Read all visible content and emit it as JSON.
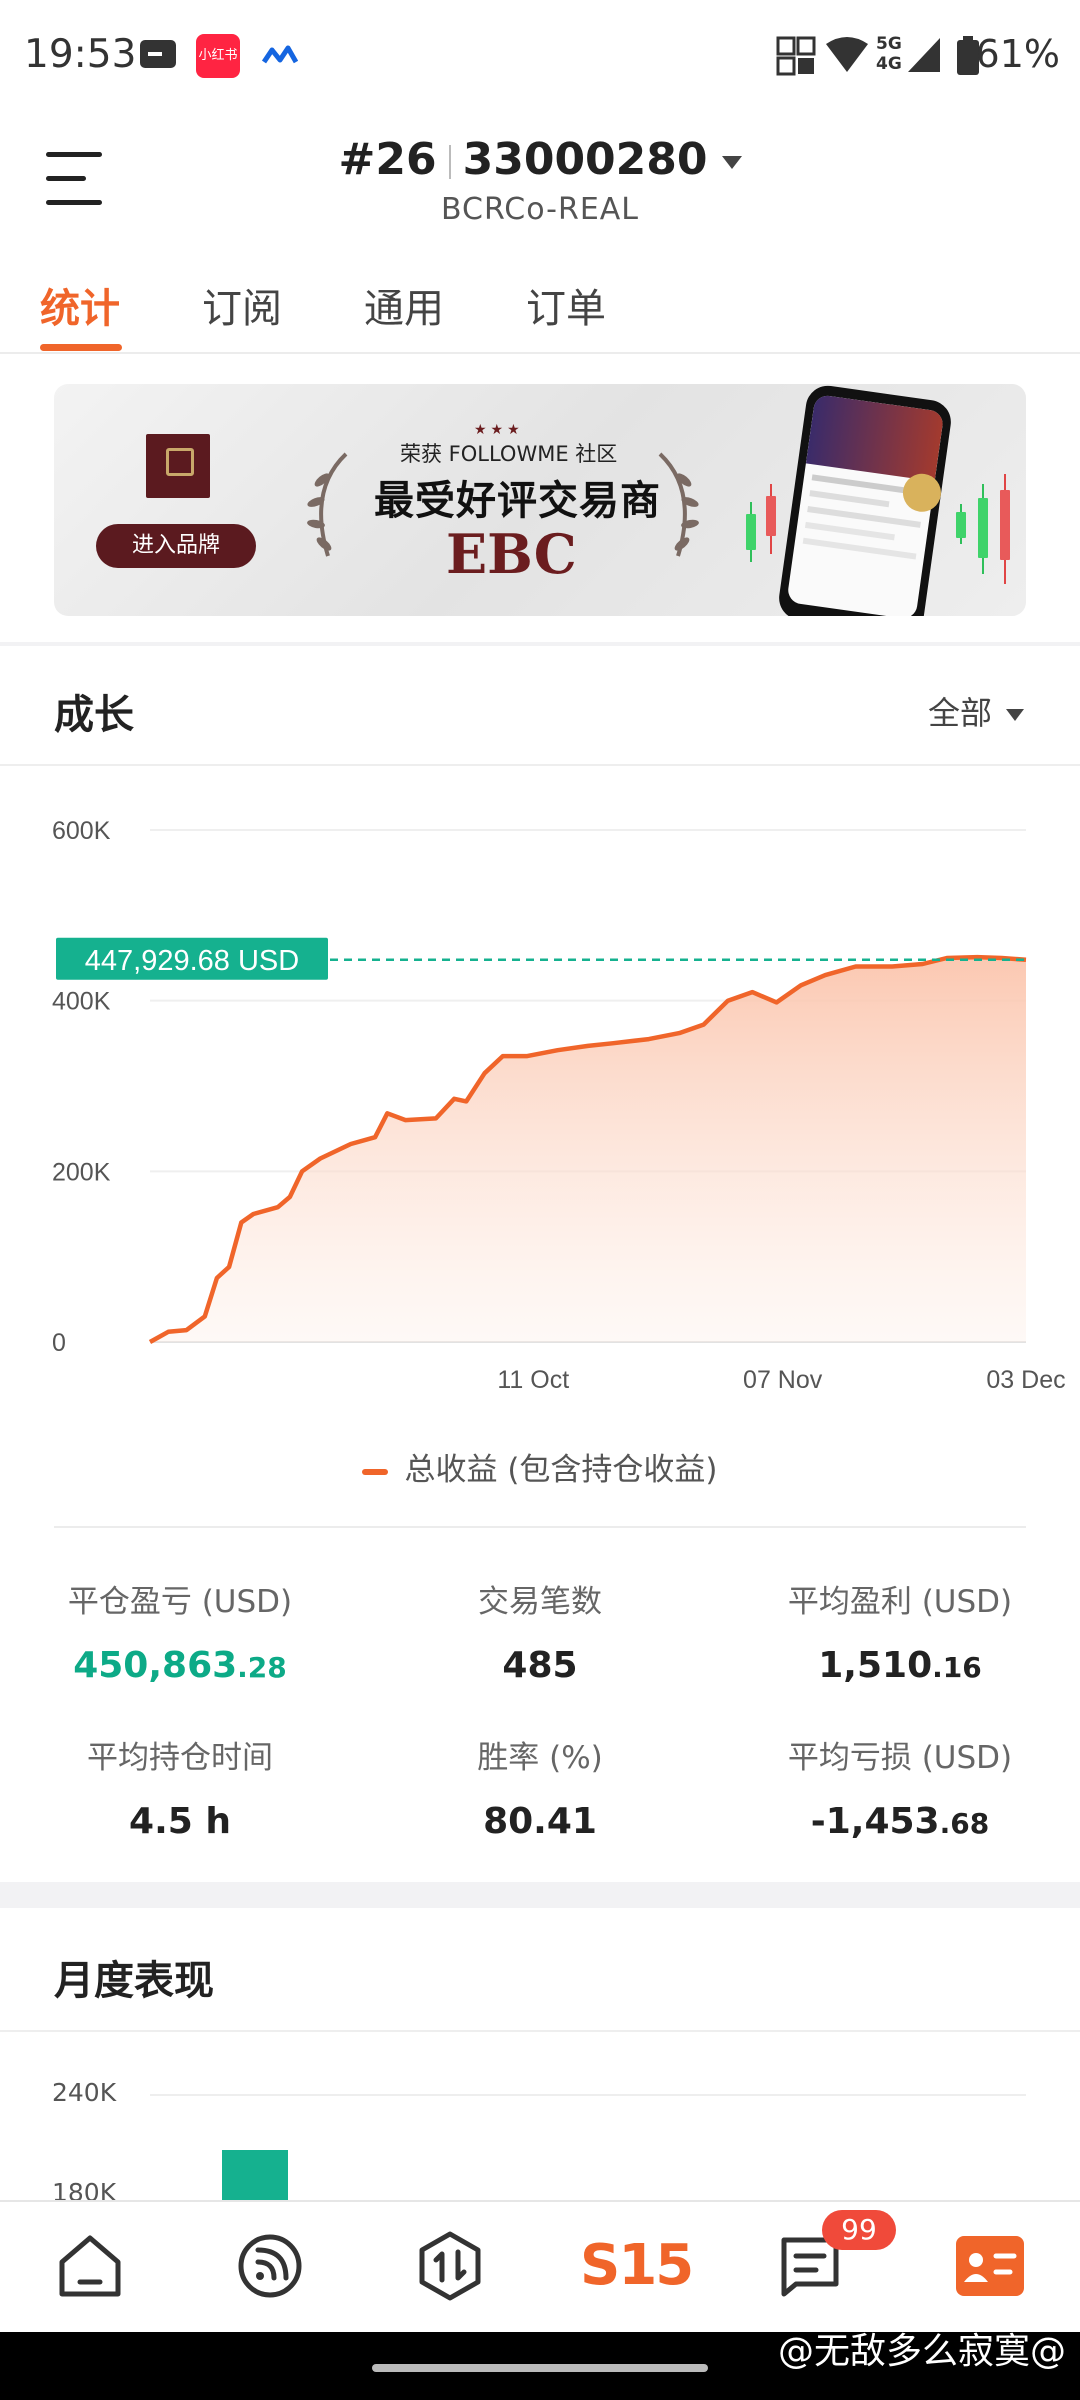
{
  "status_bar": {
    "time": "19:53",
    "battery": "61%",
    "notif_app_badge": "小红书"
  },
  "header": {
    "rank": "#26",
    "account_id": "33000280",
    "server": "BCRCo-REAL"
  },
  "tabs": [
    {
      "label": "统计",
      "active": true
    },
    {
      "label": "订阅",
      "active": false
    },
    {
      "label": "通用",
      "active": false
    },
    {
      "label": "订单",
      "active": false
    }
  ],
  "banner": {
    "button_label": "进入品牌",
    "subtitle": "荣获 FOLLOWME 社区",
    "title": "最受好评交易商",
    "brand": "EBC"
  },
  "growth": {
    "title": "成长",
    "range_label": "全部"
  },
  "chart_data": {
    "type": "area",
    "series": [
      {
        "name": "总收益 (包含持仓收益)",
        "color": "#f0652a",
        "points": [
          [
            0,
            0
          ],
          [
            0.5,
            4000
          ],
          [
            1.5,
            12000
          ],
          [
            3,
            14000
          ],
          [
            4.5,
            30000
          ],
          [
            5.5,
            75000
          ],
          [
            6.5,
            88000
          ],
          [
            7.5,
            140000
          ],
          [
            8.5,
            150000
          ],
          [
            10.5,
            158000
          ],
          [
            11.5,
            170000
          ],
          [
            12.5,
            200000
          ],
          [
            14,
            215000
          ],
          [
            16.5,
            232000
          ],
          [
            18.5,
            240000
          ],
          [
            19.5,
            268000
          ],
          [
            21,
            260000
          ],
          [
            23.5,
            262000
          ],
          [
            25,
            285000
          ],
          [
            26,
            282000
          ],
          [
            27.5,
            315000
          ],
          [
            29,
            335000
          ],
          [
            31,
            335000
          ],
          [
            33.5,
            342000
          ],
          [
            36,
            347000
          ],
          [
            38,
            350000
          ],
          [
            41,
            355000
          ],
          [
            43.5,
            362000
          ],
          [
            45.5,
            372000
          ],
          [
            47.5,
            400000
          ],
          [
            49.5,
            410000
          ],
          [
            51.5,
            398000
          ],
          [
            53.5,
            418000
          ],
          [
            55.5,
            430000
          ],
          [
            58,
            440000
          ],
          [
            61,
            440000
          ],
          [
            63.5,
            443000
          ],
          [
            65.5,
            450000
          ],
          [
            68,
            451000
          ],
          [
            70,
            450000
          ],
          [
            72,
            447929.68
          ]
        ]
      }
    ],
    "x_unit": "days since chart start",
    "x_ticks": [
      {
        "x": 31.5,
        "label": "11 Oct"
      },
      {
        "x": 52,
        "label": "07 Nov"
      },
      {
        "x": 72,
        "label": "03 Dec"
      }
    ],
    "y_ticks": [
      {
        "value": 0,
        "label": "0"
      },
      {
        "value": 200000,
        "label": "200K"
      },
      {
        "value": 400000,
        "label": "400K"
      },
      {
        "value": 600000,
        "label": "600K"
      }
    ],
    "ylim": [
      0,
      600000
    ],
    "xlim": [
      0,
      72
    ],
    "current_value": 447929.68,
    "current_label": "447,929.68 USD",
    "legend": "总收益 (包含持仓收益)",
    "grid": true,
    "fill_color": "#fbd3c2",
    "line_color": "#f0652a",
    "marker_color": "#15b18f"
  },
  "stats": [
    {
      "label": "平仓盈亏 (USD)",
      "int": "450,863",
      "dec": ".28",
      "accent": true
    },
    {
      "label": "交易笔数",
      "int": "485",
      "dec": "",
      "accent": false
    },
    {
      "label": "平均盈利 (USD)",
      "int": "1,510",
      "dec": ".16",
      "accent": false
    },
    {
      "label": "平均持仓时间",
      "int": "4.5 h",
      "dec": "",
      "accent": false
    },
    {
      "label": "胜率 (%)",
      "int": "80.41",
      "dec": "",
      "accent": false
    },
    {
      "label": "平均亏损 (USD)",
      "int": "-1,453",
      "dec": ".68",
      "accent": false
    }
  ],
  "monthly": {
    "title": "月度表现",
    "y_ticks": [
      "240K",
      "180K"
    ]
  },
  "nav": {
    "badge": "99",
    "s15_label": "S15"
  },
  "watermark": "@无敌多么寂寞@"
}
